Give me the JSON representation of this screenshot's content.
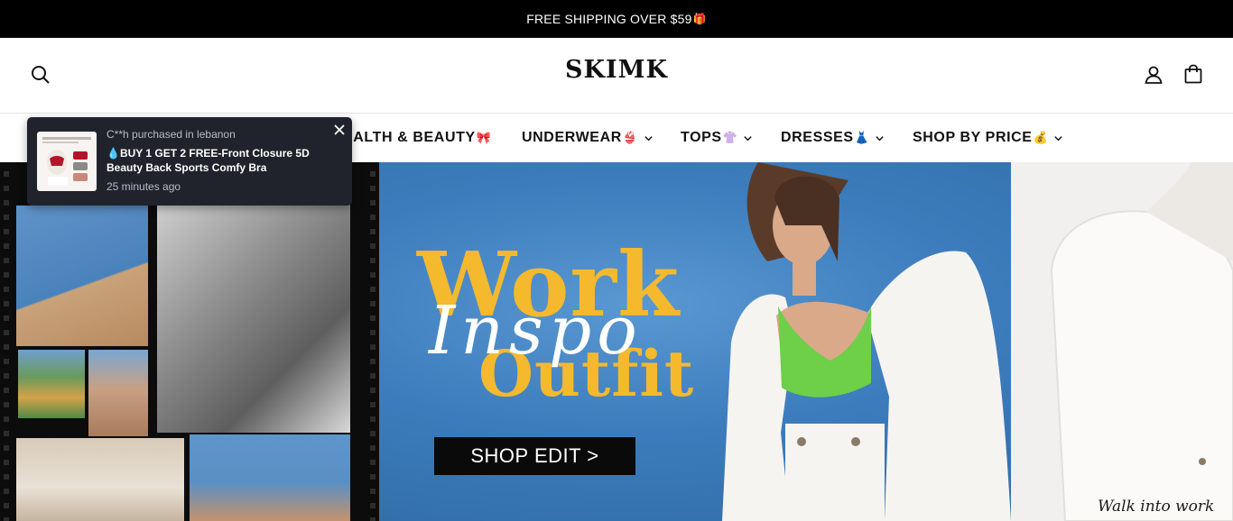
{
  "announcement": {
    "text": "FREE SHIPPING OVER $59",
    "icon": "🎁"
  },
  "header": {
    "logo": "SKIMK",
    "icons": [
      "search-icon",
      "account-icon",
      "bag-icon"
    ]
  },
  "nav": {
    "items": [
      {
        "label": "HEALTH & BEAUTY",
        "visible_label": "EALTH & BEAUTY",
        "emoji": "🎀",
        "has_dropdown": false
      },
      {
        "label": "UNDERWEAR",
        "emoji": "👙",
        "has_dropdown": true
      },
      {
        "label": "TOPS",
        "emoji": "👚",
        "has_dropdown": true
      },
      {
        "label": "DRESSES",
        "emoji": "👗",
        "has_dropdown": true
      },
      {
        "label": "SHOP BY PRICE",
        "emoji": "💰",
        "has_dropdown": true
      }
    ]
  },
  "hero": {
    "headline_1": "Work",
    "headline_script": "Inspo",
    "headline_2": "Outfit",
    "cta": "SHOP EDIT >",
    "side_caption": "Walk into work"
  },
  "toast": {
    "buyer": "C**h purchased in lebanon",
    "product": "💧BUY 1 GET 2 FREE-Front Closure 5D Beauty Back Sports Comfy Bra",
    "time": "25 minutes ago"
  },
  "colors": {
    "accent_yellow": "#f5b92e",
    "hero_blue": "#3d7dbd",
    "toast_bg": "#20232b"
  }
}
